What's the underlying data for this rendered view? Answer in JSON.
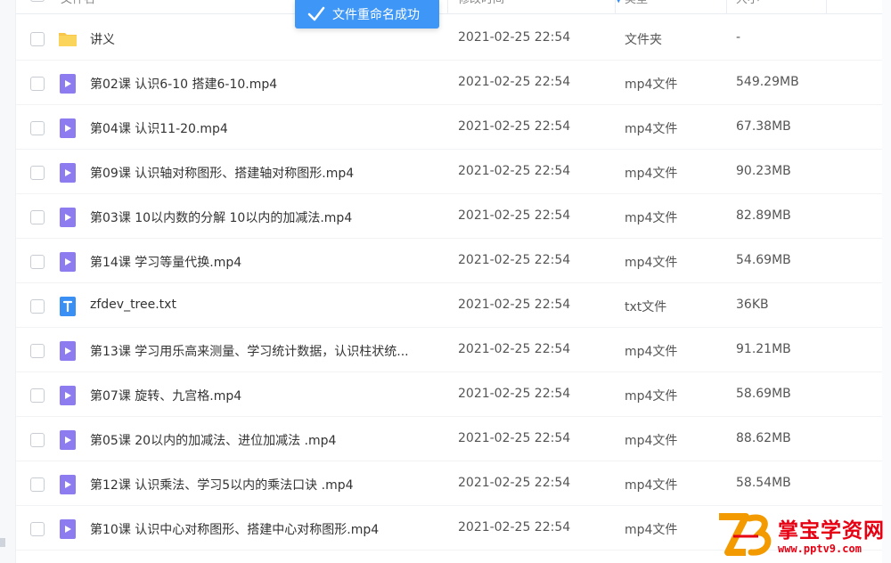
{
  "header": {
    "name_label": "文件名",
    "time_label": "修改时间",
    "type_label": "类型",
    "size_label": "大小"
  },
  "toast": {
    "message": "文件重命名成功"
  },
  "files": [
    {
      "name": "讲义",
      "time": "2021-02-25 22:54",
      "type": "文件夹",
      "size": "-",
      "icon": "folder-icon"
    },
    {
      "name": "第02课 认识6-10 搭建6-10.mp4",
      "time": "2021-02-25 22:54",
      "type": "mp4文件",
      "size": "549.29MB",
      "icon": "video-file-icon"
    },
    {
      "name": "第04课 认识11-20.mp4",
      "time": "2021-02-25 22:54",
      "type": "mp4文件",
      "size": "67.38MB",
      "icon": "video-file-icon"
    },
    {
      "name": "第09课 认识轴对称图形、搭建轴对称图形.mp4",
      "time": "2021-02-25 22:54",
      "type": "mp4文件",
      "size": "90.23MB",
      "icon": "video-file-icon"
    },
    {
      "name": "第03课 10以内数的分解 10以内的加减法.mp4",
      "time": "2021-02-25 22:54",
      "type": "mp4文件",
      "size": "82.89MB",
      "icon": "video-file-icon"
    },
    {
      "name": "第14课 学习等量代换.mp4",
      "time": "2021-02-25 22:54",
      "type": "mp4文件",
      "size": "54.69MB",
      "icon": "video-file-icon"
    },
    {
      "name": "zfdev_tree.txt",
      "time": "2021-02-25 22:54",
      "type": "txt文件",
      "size": "36KB",
      "icon": "text-file-icon"
    },
    {
      "name": "第13课 学习用乐高来测量、学习统计数据，认识柱状统...",
      "time": "2021-02-25 22:54",
      "type": "mp4文件",
      "size": "91.21MB",
      "icon": "video-file-icon"
    },
    {
      "name": "第07课 旋转、九宫格.mp4",
      "time": "2021-02-25 22:54",
      "type": "mp4文件",
      "size": "58.69MB",
      "icon": "video-file-icon"
    },
    {
      "name": "第05课 20以内的加减法、进位加减法 .mp4",
      "time": "2021-02-25 22:54",
      "type": "mp4文件",
      "size": "88.62MB",
      "icon": "video-file-icon"
    },
    {
      "name": "第12课 认识乘法、学习5以内的乘法口诀 .mp4",
      "time": "2021-02-25 22:54",
      "type": "mp4文件",
      "size": "58.54MB",
      "icon": "video-file-icon"
    },
    {
      "name": "第10课 认识中心对称图形、搭建中心对称图形.mp4",
      "time": "2021-02-25 22:54",
      "type": "mp4文件",
      "size": "",
      "icon": "video-file-icon"
    }
  ],
  "watermark": {
    "title": "掌宝学资网",
    "url": "www.pptv9.com"
  },
  "colors": {
    "accent": "#3e97f7",
    "video_icon": "#8c7cf0",
    "folder": "#f7c64a",
    "text_icon": "#3a8ff5",
    "watermark": "#e60012"
  }
}
